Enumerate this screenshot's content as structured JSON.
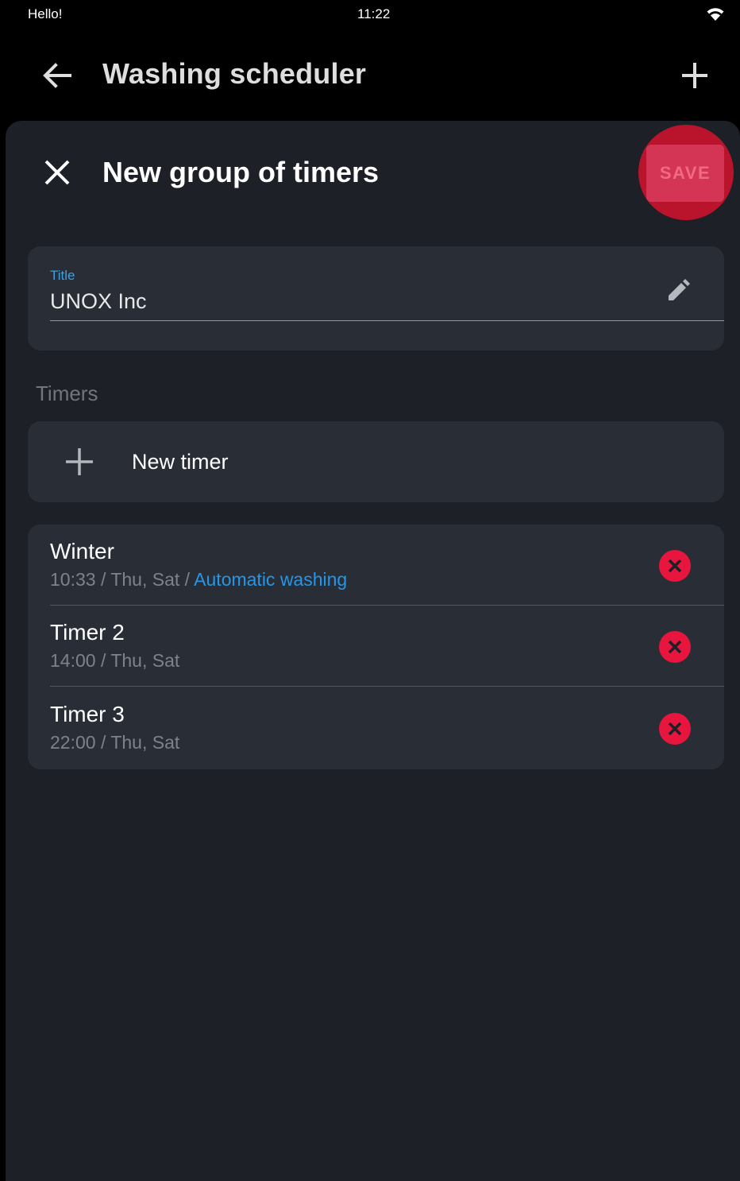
{
  "status_bar": {
    "left_text": "Hello!",
    "time": "11:22",
    "wifi_icon": "wifi-icon"
  },
  "app_bar": {
    "title": "Washing scheduler",
    "back_icon": "arrow-left-icon",
    "add_icon": "plus-icon"
  },
  "sheet": {
    "title": "New group of timers",
    "close_icon": "close-icon",
    "save_label": "SAVE",
    "title_field": {
      "label": "Title",
      "value": "UNOX Inc",
      "edit_icon": "pencil-icon"
    },
    "timers_section_label": "Timers",
    "new_timer_label": "New timer",
    "timers": [
      {
        "name": "Winter",
        "time": "10:33",
        "days": "Thu, Sat",
        "mode": "Automatic washing"
      },
      {
        "name": "Timer 2",
        "time": "14:00",
        "days": "Thu, Sat",
        "mode": ""
      },
      {
        "name": "Timer 3",
        "time": "22:00",
        "days": "Thu, Sat",
        "mode": ""
      }
    ]
  },
  "colors": {
    "background": "#000000",
    "sheet_background": "#1d2027",
    "card_background": "#292e36",
    "accent_blue": "#2596e8",
    "delete_red": "#e8163f",
    "save_highlight": "#c8142d"
  }
}
